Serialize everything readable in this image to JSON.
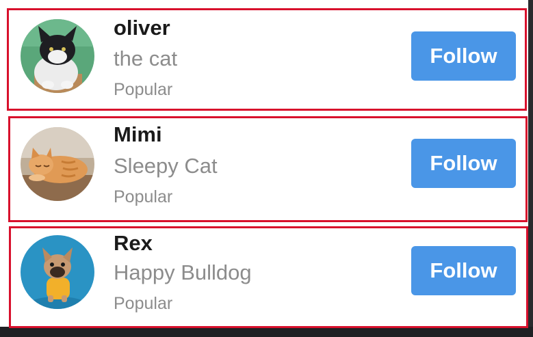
{
  "profiles": [
    {
      "name": "oliver",
      "subtitle": "the cat",
      "tag": "Popular",
      "button_label": "Follow",
      "avatar_icon": "cat-avatar-icon"
    },
    {
      "name": "Mimi",
      "subtitle": "Sleepy Cat",
      "tag": "Popular",
      "button_label": "Follow",
      "avatar_icon": "sleeping-cat-avatar-icon"
    },
    {
      "name": "Rex",
      "subtitle": "Happy Bulldog",
      "tag": "Popular",
      "button_label": "Follow",
      "avatar_icon": "bulldog-avatar-icon"
    }
  ],
  "colors": {
    "follow_button": "#4a96e7",
    "card_outline": "#d8102c",
    "name_text": "#1a1a1a",
    "secondary_text": "#8c8c8c"
  }
}
